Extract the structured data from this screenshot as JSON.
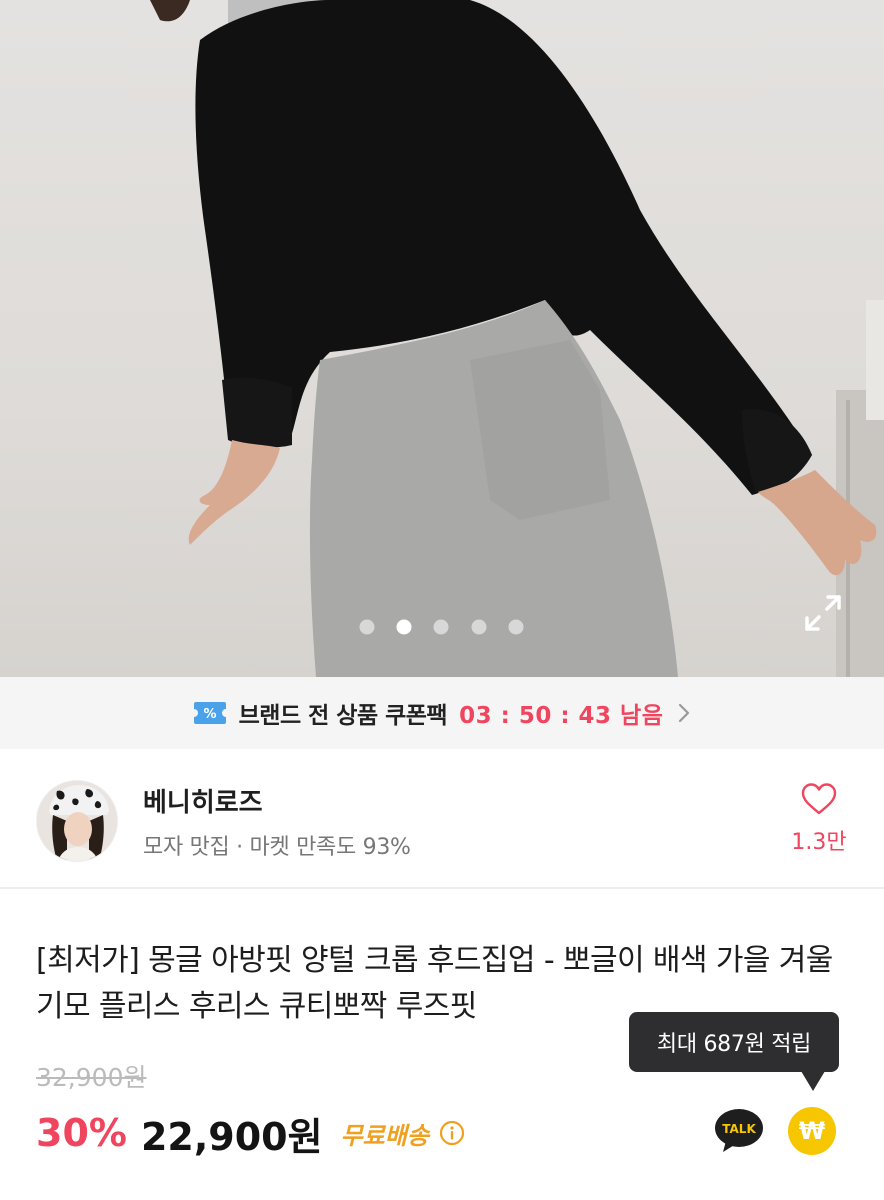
{
  "gallery": {
    "slide_count": 5,
    "active_index": 1,
    "expand_icon": "expand-icon"
  },
  "coupon": {
    "icon": "coupon-icon",
    "text": "브랜드 전 상품 쿠폰팩",
    "timer": "03 : 50 : 43 남음",
    "accent": "#f0455e"
  },
  "seller": {
    "name": "베니히로즈",
    "subtitle": "모자 맛집 · 마켓 만족도 93%",
    "likes": "1.3만"
  },
  "product": {
    "title": "[최저가] 몽글 아방핏 양털 크롭 후드집업 - 뽀글이 배색 가을 겨울 기모 플리스 후리스 큐티뽀짝 루즈핏",
    "original_price": "32,900원",
    "discount": "30%",
    "price": "22,900원",
    "shipping": "무료배송"
  },
  "tooltip": {
    "text": "최대 687원 적립"
  },
  "actions": {
    "talk_label": "TALK",
    "won_glyph": "₩"
  },
  "colors": {
    "accent_pink": "#f0455e",
    "shipping_orange": "#f0a020",
    "point_yellow": "#f6c600",
    "coupon_blue": "#4aa3ea"
  }
}
